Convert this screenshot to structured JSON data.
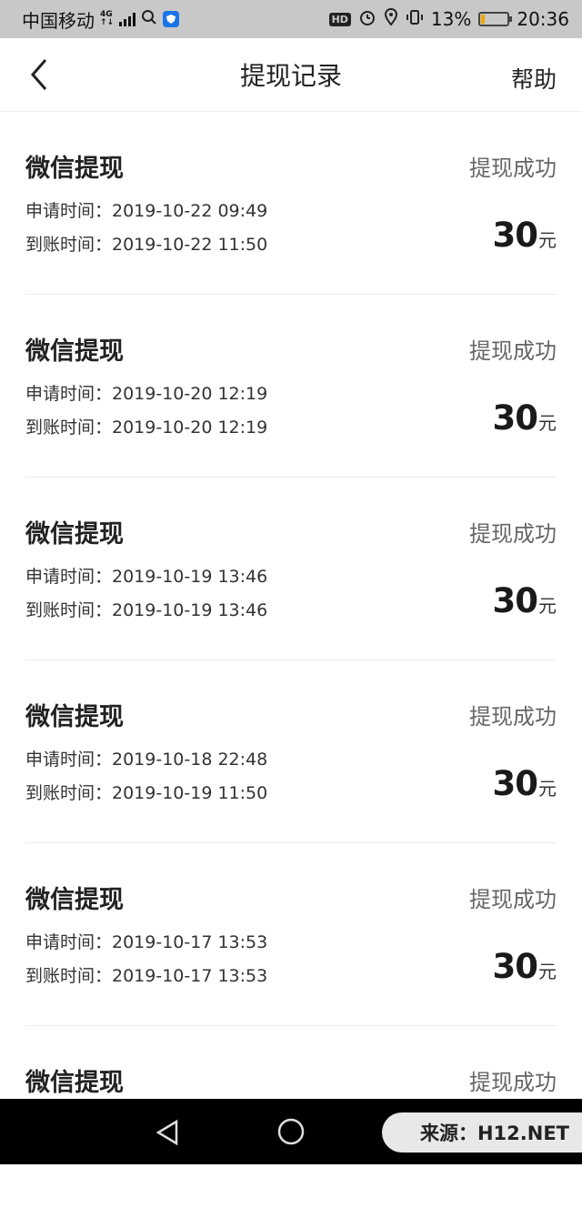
{
  "status_bar": {
    "carrier": "中国移动",
    "network": "4G",
    "battery_percent": "13%",
    "battery_level": 0.13,
    "time": "20:36",
    "hd_label": "HD"
  },
  "header": {
    "title": "提现记录",
    "help_label": "帮助"
  },
  "records": [
    {
      "title": "微信提现",
      "status": "提现成功",
      "apply": "申请时间：2019-10-22 09:49",
      "arrive": "到账时间：2019-10-22 11:50",
      "amount": "30",
      "unit": "元"
    },
    {
      "title": "微信提现",
      "status": "提现成功",
      "apply": "申请时间：2019-10-20 12:19",
      "arrive": "到账时间：2019-10-20 12:19",
      "amount": "30",
      "unit": "元"
    },
    {
      "title": "微信提现",
      "status": "提现成功",
      "apply": "申请时间：2019-10-19 13:46",
      "arrive": "到账时间：2019-10-19 13:46",
      "amount": "30",
      "unit": "元"
    },
    {
      "title": "微信提现",
      "status": "提现成功",
      "apply": "申请时间：2019-10-18 22:48",
      "arrive": "到账时间：2019-10-19 11:50",
      "amount": "30",
      "unit": "元"
    },
    {
      "title": "微信提现",
      "status": "提现成功",
      "apply": "申请时间：2019-10-17 13:53",
      "arrive": "到账时间：2019-10-17 13:53",
      "amount": "30",
      "unit": "元"
    },
    {
      "title": "微信提现",
      "status": "提现成功",
      "apply": "",
      "arrive": "",
      "amount": "",
      "unit": ""
    }
  ],
  "watermark": "来源：H12.NET",
  "icons": {
    "back": "chevron-left-icon",
    "nav_back": "triangle-back-icon",
    "nav_home": "circle-home-icon"
  }
}
